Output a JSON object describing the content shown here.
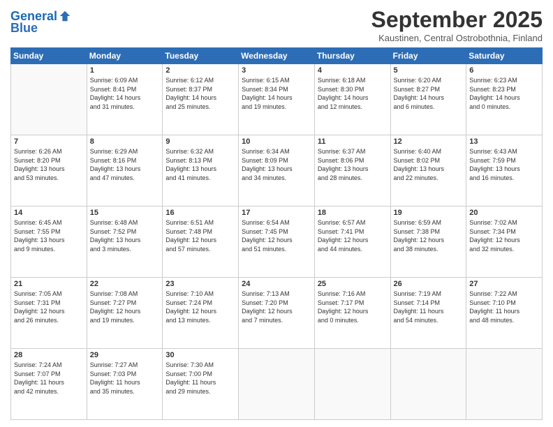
{
  "header": {
    "logo_line1": "General",
    "logo_line2": "Blue",
    "month": "September 2025",
    "location": "Kaustinen, Central Ostrobothnia, Finland"
  },
  "weekdays": [
    "Sunday",
    "Monday",
    "Tuesday",
    "Wednesday",
    "Thursday",
    "Friday",
    "Saturday"
  ],
  "weeks": [
    [
      {
        "day": "",
        "info": ""
      },
      {
        "day": "1",
        "info": "Sunrise: 6:09 AM\nSunset: 8:41 PM\nDaylight: 14 hours\nand 31 minutes."
      },
      {
        "day": "2",
        "info": "Sunrise: 6:12 AM\nSunset: 8:37 PM\nDaylight: 14 hours\nand 25 minutes."
      },
      {
        "day": "3",
        "info": "Sunrise: 6:15 AM\nSunset: 8:34 PM\nDaylight: 14 hours\nand 19 minutes."
      },
      {
        "day": "4",
        "info": "Sunrise: 6:18 AM\nSunset: 8:30 PM\nDaylight: 14 hours\nand 12 minutes."
      },
      {
        "day": "5",
        "info": "Sunrise: 6:20 AM\nSunset: 8:27 PM\nDaylight: 14 hours\nand 6 minutes."
      },
      {
        "day": "6",
        "info": "Sunrise: 6:23 AM\nSunset: 8:23 PM\nDaylight: 14 hours\nand 0 minutes."
      }
    ],
    [
      {
        "day": "7",
        "info": "Sunrise: 6:26 AM\nSunset: 8:20 PM\nDaylight: 13 hours\nand 53 minutes."
      },
      {
        "day": "8",
        "info": "Sunrise: 6:29 AM\nSunset: 8:16 PM\nDaylight: 13 hours\nand 47 minutes."
      },
      {
        "day": "9",
        "info": "Sunrise: 6:32 AM\nSunset: 8:13 PM\nDaylight: 13 hours\nand 41 minutes."
      },
      {
        "day": "10",
        "info": "Sunrise: 6:34 AM\nSunset: 8:09 PM\nDaylight: 13 hours\nand 34 minutes."
      },
      {
        "day": "11",
        "info": "Sunrise: 6:37 AM\nSunset: 8:06 PM\nDaylight: 13 hours\nand 28 minutes."
      },
      {
        "day": "12",
        "info": "Sunrise: 6:40 AM\nSunset: 8:02 PM\nDaylight: 13 hours\nand 22 minutes."
      },
      {
        "day": "13",
        "info": "Sunrise: 6:43 AM\nSunset: 7:59 PM\nDaylight: 13 hours\nand 16 minutes."
      }
    ],
    [
      {
        "day": "14",
        "info": "Sunrise: 6:45 AM\nSunset: 7:55 PM\nDaylight: 13 hours\nand 9 minutes."
      },
      {
        "day": "15",
        "info": "Sunrise: 6:48 AM\nSunset: 7:52 PM\nDaylight: 13 hours\nand 3 minutes."
      },
      {
        "day": "16",
        "info": "Sunrise: 6:51 AM\nSunset: 7:48 PM\nDaylight: 12 hours\nand 57 minutes."
      },
      {
        "day": "17",
        "info": "Sunrise: 6:54 AM\nSunset: 7:45 PM\nDaylight: 12 hours\nand 51 minutes."
      },
      {
        "day": "18",
        "info": "Sunrise: 6:57 AM\nSunset: 7:41 PM\nDaylight: 12 hours\nand 44 minutes."
      },
      {
        "day": "19",
        "info": "Sunrise: 6:59 AM\nSunset: 7:38 PM\nDaylight: 12 hours\nand 38 minutes."
      },
      {
        "day": "20",
        "info": "Sunrise: 7:02 AM\nSunset: 7:34 PM\nDaylight: 12 hours\nand 32 minutes."
      }
    ],
    [
      {
        "day": "21",
        "info": "Sunrise: 7:05 AM\nSunset: 7:31 PM\nDaylight: 12 hours\nand 26 minutes."
      },
      {
        "day": "22",
        "info": "Sunrise: 7:08 AM\nSunset: 7:27 PM\nDaylight: 12 hours\nand 19 minutes."
      },
      {
        "day": "23",
        "info": "Sunrise: 7:10 AM\nSunset: 7:24 PM\nDaylight: 12 hours\nand 13 minutes."
      },
      {
        "day": "24",
        "info": "Sunrise: 7:13 AM\nSunset: 7:20 PM\nDaylight: 12 hours\nand 7 minutes."
      },
      {
        "day": "25",
        "info": "Sunrise: 7:16 AM\nSunset: 7:17 PM\nDaylight: 12 hours\nand 0 minutes."
      },
      {
        "day": "26",
        "info": "Sunrise: 7:19 AM\nSunset: 7:14 PM\nDaylight: 11 hours\nand 54 minutes."
      },
      {
        "day": "27",
        "info": "Sunrise: 7:22 AM\nSunset: 7:10 PM\nDaylight: 11 hours\nand 48 minutes."
      }
    ],
    [
      {
        "day": "28",
        "info": "Sunrise: 7:24 AM\nSunset: 7:07 PM\nDaylight: 11 hours\nand 42 minutes."
      },
      {
        "day": "29",
        "info": "Sunrise: 7:27 AM\nSunset: 7:03 PM\nDaylight: 11 hours\nand 35 minutes."
      },
      {
        "day": "30",
        "info": "Sunrise: 7:30 AM\nSunset: 7:00 PM\nDaylight: 11 hours\nand 29 minutes."
      },
      {
        "day": "",
        "info": ""
      },
      {
        "day": "",
        "info": ""
      },
      {
        "day": "",
        "info": ""
      },
      {
        "day": "",
        "info": ""
      }
    ]
  ]
}
